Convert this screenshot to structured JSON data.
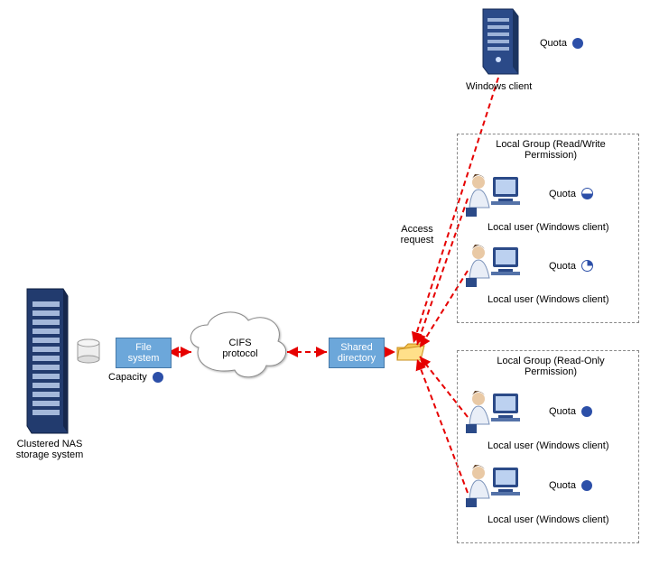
{
  "nas": {
    "caption": "Clustered NAS\nstorage system",
    "capacity_label": "Capacity"
  },
  "fs_box": "File\nsystem",
  "cloud_label": "CIFS\nprotocol",
  "shared_box": "Shared\ndirectory",
  "access_request": "Access\nrequest",
  "windows_client": {
    "caption": "Windows client",
    "quota_label": "Quota"
  },
  "group_rw": {
    "title": "Local Group (Read/Write\nPermission)",
    "users": [
      {
        "quota_label": "Quota",
        "caption": "Local user (Windows client)"
      },
      {
        "quota_label": "Quota",
        "caption": "Local user (Windows client)"
      }
    ]
  },
  "group_ro": {
    "title": "Local Group (Read-Only\nPermission)",
    "users": [
      {
        "quota_label": "Quota",
        "caption": "Local user (Windows client)"
      },
      {
        "quota_label": "Quota",
        "caption": "Local user (Windows client)"
      }
    ]
  }
}
